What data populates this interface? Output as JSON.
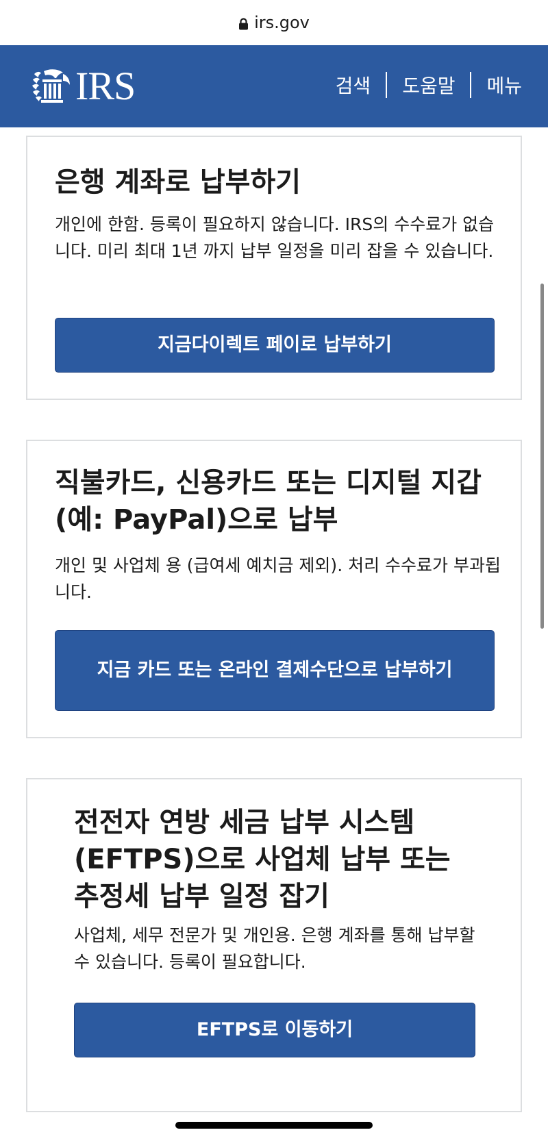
{
  "browser": {
    "url": "irs.gov",
    "lock_icon": "lock-icon"
  },
  "header": {
    "logo_text": "IRS",
    "logo_icon": "eagle-icon",
    "nav": {
      "search": "검색",
      "help": "도움말",
      "menu": "메뉴"
    },
    "color": "#2c5aa0"
  },
  "cards": [
    {
      "title": "은행 계좌로 납부하기",
      "description": "개인에 한함. 등록이 필요하지 않습니다. IRS의 수수료가 없습니다. 미리 최대 1년 까지 납부 일정을 미리 잡을 수 있습니다.",
      "button": "지금다이렉트 페이로 납부하기"
    },
    {
      "title": "직불카드, 신용카드 또는 디지털 지갑 (예: PayPal)으로 납부",
      "description": "개인 및 사업체 용 (급여세 예치금 제외). 처리 수수료가 부과됩니다.",
      "button": "지금 카드 또는 온라인 결제수단으로 납부하기"
    },
    {
      "title": "전전자 연방 세금 납부 시스템 (EFTPS)으로 사업체 납부 또는 추정세 납부 일정 잡기",
      "description": "사업체, 세무 전문가 및 개인용. 은행 계좌를 통해 납부할 수 있습니다. 등록이 필요합니다.",
      "button": "EFTPS로 이동하기"
    }
  ],
  "colors": {
    "brand_blue": "#2c5aa0",
    "card_border": "#dcdee0"
  }
}
